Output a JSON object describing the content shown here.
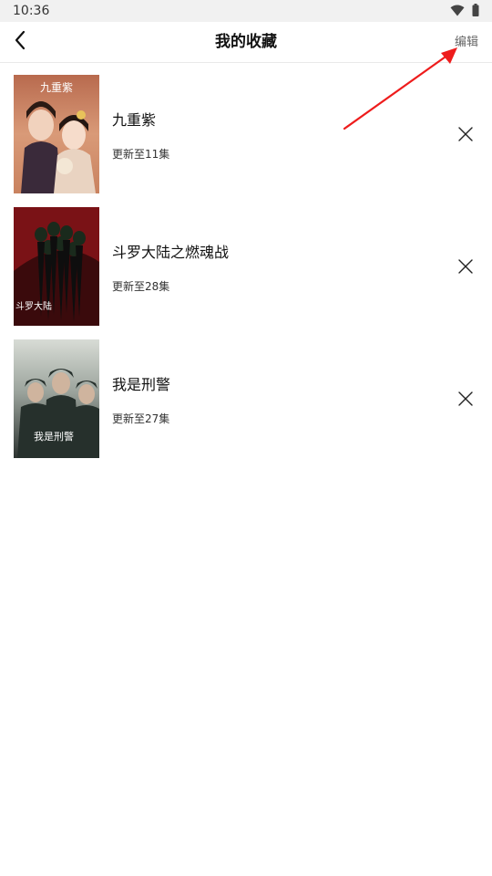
{
  "status_bar": {
    "time": "10:36",
    "icons": [
      "wifi-icon",
      "battery-icon"
    ]
  },
  "header": {
    "back_icon": "back-arrow-icon",
    "title": "我的收藏",
    "edit_label": "编辑"
  },
  "favorites": [
    {
      "title": "九重紫",
      "subtitle": "更新至11集",
      "poster_text": "九重紫",
      "remove_icon": "close-icon"
    },
    {
      "title": "斗罗大陆之燃魂战",
      "subtitle": "更新至28集",
      "poster_text": "斗罗大陆",
      "remove_icon": "close-icon"
    },
    {
      "title": "我是刑警",
      "subtitle": "更新至27集",
      "poster_text": "我是刑警",
      "remove_icon": "close-icon"
    }
  ],
  "colors": {
    "annotation_arrow": "#ee1c1c",
    "divider": "#e9e9e9",
    "status_bar_bg": "#f1f1f1"
  }
}
